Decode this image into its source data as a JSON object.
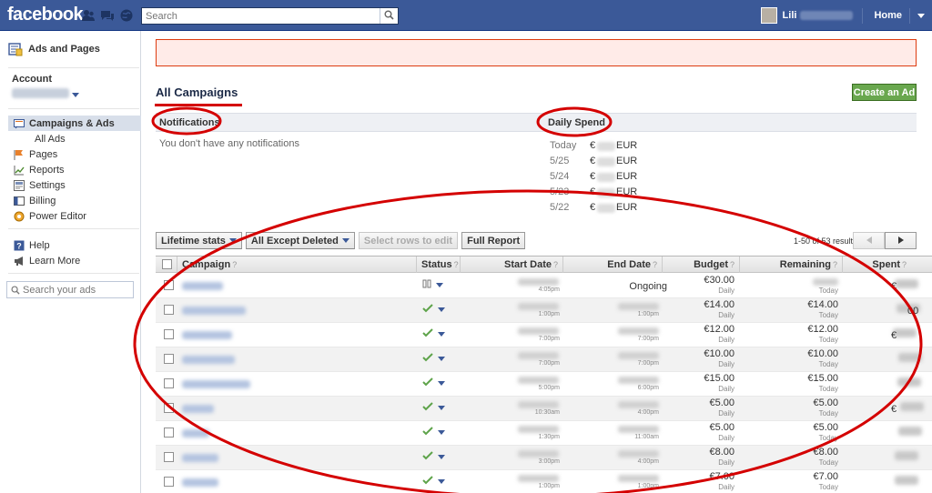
{
  "topbar": {
    "logo": "facebook",
    "search_placeholder": "Search",
    "user_name": "Lili",
    "home": "Home"
  },
  "sidebar": {
    "title": "Ads and Pages",
    "account_label": "Account",
    "nav": [
      {
        "label": "Campaigns & Ads",
        "icon": "campaigns-icon",
        "active": true
      },
      {
        "label": "All Ads",
        "icon": ""
      },
      {
        "label": "Pages",
        "icon": "pages-flag-icon"
      },
      {
        "label": "Reports",
        "icon": "reports-chart-icon"
      },
      {
        "label": "Settings",
        "icon": "settings-icon"
      },
      {
        "label": "Billing",
        "icon": "billing-icon"
      },
      {
        "label": "Power Editor",
        "icon": "power-editor-icon"
      },
      {
        "label": "Help",
        "icon": "help-icon"
      },
      {
        "label": "Learn More",
        "icon": "megaphone-icon"
      }
    ],
    "search_placeholder": "Search your ads"
  },
  "main": {
    "title": "All Campaigns",
    "create_button": "Create an Ad",
    "notifications_title": "Notifications",
    "notifications_empty": "You don't have any notifications",
    "daily_spend_title": "Daily Spend",
    "daily_spend": [
      {
        "date": "Today",
        "currency": "€",
        "unit": "EUR"
      },
      {
        "date": "5/25",
        "currency": "€",
        "unit": "EUR"
      },
      {
        "date": "5/24",
        "currency": "€",
        "unit": "EUR"
      },
      {
        "date": "5/23",
        "currency": "€",
        "unit": "EUR"
      },
      {
        "date": "5/22",
        "currency": "€",
        "unit": "EUR"
      }
    ],
    "toolbar": {
      "lifetime_stats": "Lifetime stats",
      "filter": "All Except Deleted",
      "select_rows": "Select rows to edit",
      "full_report": "Full Report"
    },
    "results": "1-50 of 53 results",
    "columns": {
      "campaign": "Campaign",
      "status": "Status",
      "start_date": "Start Date",
      "end_date": "End Date",
      "budget": "Budget",
      "remaining": "Remaining",
      "spent": "Spent",
      "help_mark": "?"
    },
    "rows": [
      {
        "status": "paused",
        "start_time": "4:05pm",
        "end": "Ongoing",
        "end_time": "",
        "budget": "€30.00",
        "budget_period": "Daily",
        "remaining": "",
        "remaining_period": "Today",
        "spent_frag": "€"
      },
      {
        "status": "active",
        "start_time": "1:00pm",
        "end": "",
        "end_time": "1:00pm",
        "budget": "€14.00",
        "budget_period": "Daily",
        "remaining": "€14.00",
        "remaining_period": "Today",
        "spent_frag": "00"
      },
      {
        "status": "active",
        "start_time": "7:00pm",
        "end": "",
        "end_time": "7:00pm",
        "budget": "€12.00",
        "budget_period": "Daily",
        "remaining": "€12.00",
        "remaining_period": "Today",
        "spent_frag": "€"
      },
      {
        "status": "active",
        "start_time": "7:00pm",
        "end": "",
        "end_time": "7:00pm",
        "budget": "€10.00",
        "budget_period": "Daily",
        "remaining": "€10.00",
        "remaining_period": "Today",
        "spent_frag": ""
      },
      {
        "status": "active",
        "start_time": "5:00pm",
        "end": "",
        "end_time": "6:00pm",
        "budget": "€15.00",
        "budget_period": "Daily",
        "remaining": "€15.00",
        "remaining_period": "Today",
        "spent_frag": ""
      },
      {
        "status": "active",
        "start_time": "10:30am",
        "end": "",
        "end_time": "4:00pm",
        "budget": "€5.00",
        "budget_period": "Daily",
        "remaining": "€5.00",
        "remaining_period": "Today",
        "spent_frag": "€"
      },
      {
        "status": "active",
        "start_time": "1:30pm",
        "end": "",
        "end_time": "11:00am",
        "budget": "€5.00",
        "budget_period": "Daily",
        "remaining": "€5.00",
        "remaining_period": "Today",
        "spent_frag": ""
      },
      {
        "status": "active",
        "start_time": "3:00pm",
        "end": "",
        "end_time": "4:00pm",
        "budget": "€8.00",
        "budget_period": "Daily",
        "remaining": "€8.00",
        "remaining_period": "Today",
        "spent_frag": ""
      },
      {
        "status": "active",
        "start_time": "1:00pm",
        "end": "",
        "end_time": "1:00pm",
        "budget": "€7.00",
        "budget_period": "Daily",
        "remaining": "€7.00",
        "remaining_period": "Today",
        "spent_frag": ""
      }
    ]
  },
  "colors": {
    "fb_blue": "#3b5998",
    "create_green": "#69a74e",
    "annotation_red": "#d40000",
    "active_check": "#5ea34a"
  }
}
